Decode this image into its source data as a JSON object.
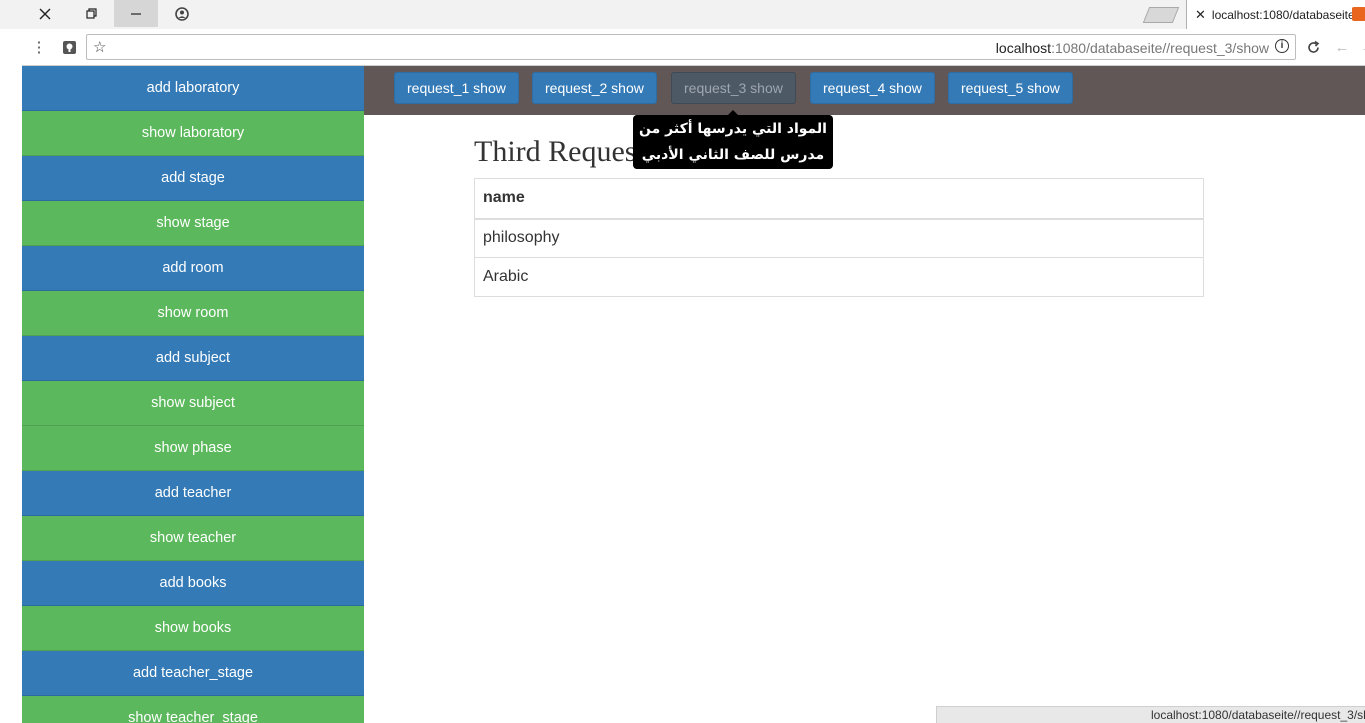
{
  "browser": {
    "tab_title": "localhost:1080/databaseite",
    "url_host": "localhost",
    "url_path": ":1080/databaseite//request_3/show",
    "status_url": "localhost:1080/databaseite//request_3/sh"
  },
  "sidebar": {
    "items": [
      {
        "label": "add laboratory",
        "color": "#337ab7"
      },
      {
        "label": "show laboratory",
        "color": "#5cb85c"
      },
      {
        "label": "add stage",
        "color": "#337ab7"
      },
      {
        "label": "show stage",
        "color": "#5cb85c"
      },
      {
        "label": "add room",
        "color": "#337ab7"
      },
      {
        "label": "show room",
        "color": "#5cb85c"
      },
      {
        "label": "add subject",
        "color": "#337ab7"
      },
      {
        "label": "show subject",
        "color": "#5cb85c"
      },
      {
        "label": "show phase",
        "color": "#5cb85c"
      },
      {
        "label": "add teacher",
        "color": "#337ab7"
      },
      {
        "label": "show teacher",
        "color": "#5cb85c"
      },
      {
        "label": "add books",
        "color": "#337ab7"
      },
      {
        "label": "show books",
        "color": "#5cb85c"
      },
      {
        "label": "add teacher_stage",
        "color": "#337ab7"
      },
      {
        "label": "show teacher_stage",
        "color": "#5cb85c"
      }
    ]
  },
  "navbar": {
    "buttons": [
      {
        "label": "request_1 show",
        "active": false
      },
      {
        "label": "request_2 show",
        "active": false
      },
      {
        "label": "request_3 show",
        "active": true
      },
      {
        "label": "request_4 show",
        "active": false
      },
      {
        "label": "request_5 show",
        "active": false
      }
    ]
  },
  "tooltip": {
    "line1": "المواد التي يدرسها أكثر من",
    "line2": "مدرس للصف الثاني الأدبي"
  },
  "main": {
    "heading": "Third Request",
    "table": {
      "header": "name",
      "rows": [
        "philosophy",
        "Arabic"
      ]
    }
  },
  "colors": {
    "primary": "#337ab7",
    "success": "#5cb85c",
    "navbar": "#615756",
    "active_button": "#4d5965"
  }
}
